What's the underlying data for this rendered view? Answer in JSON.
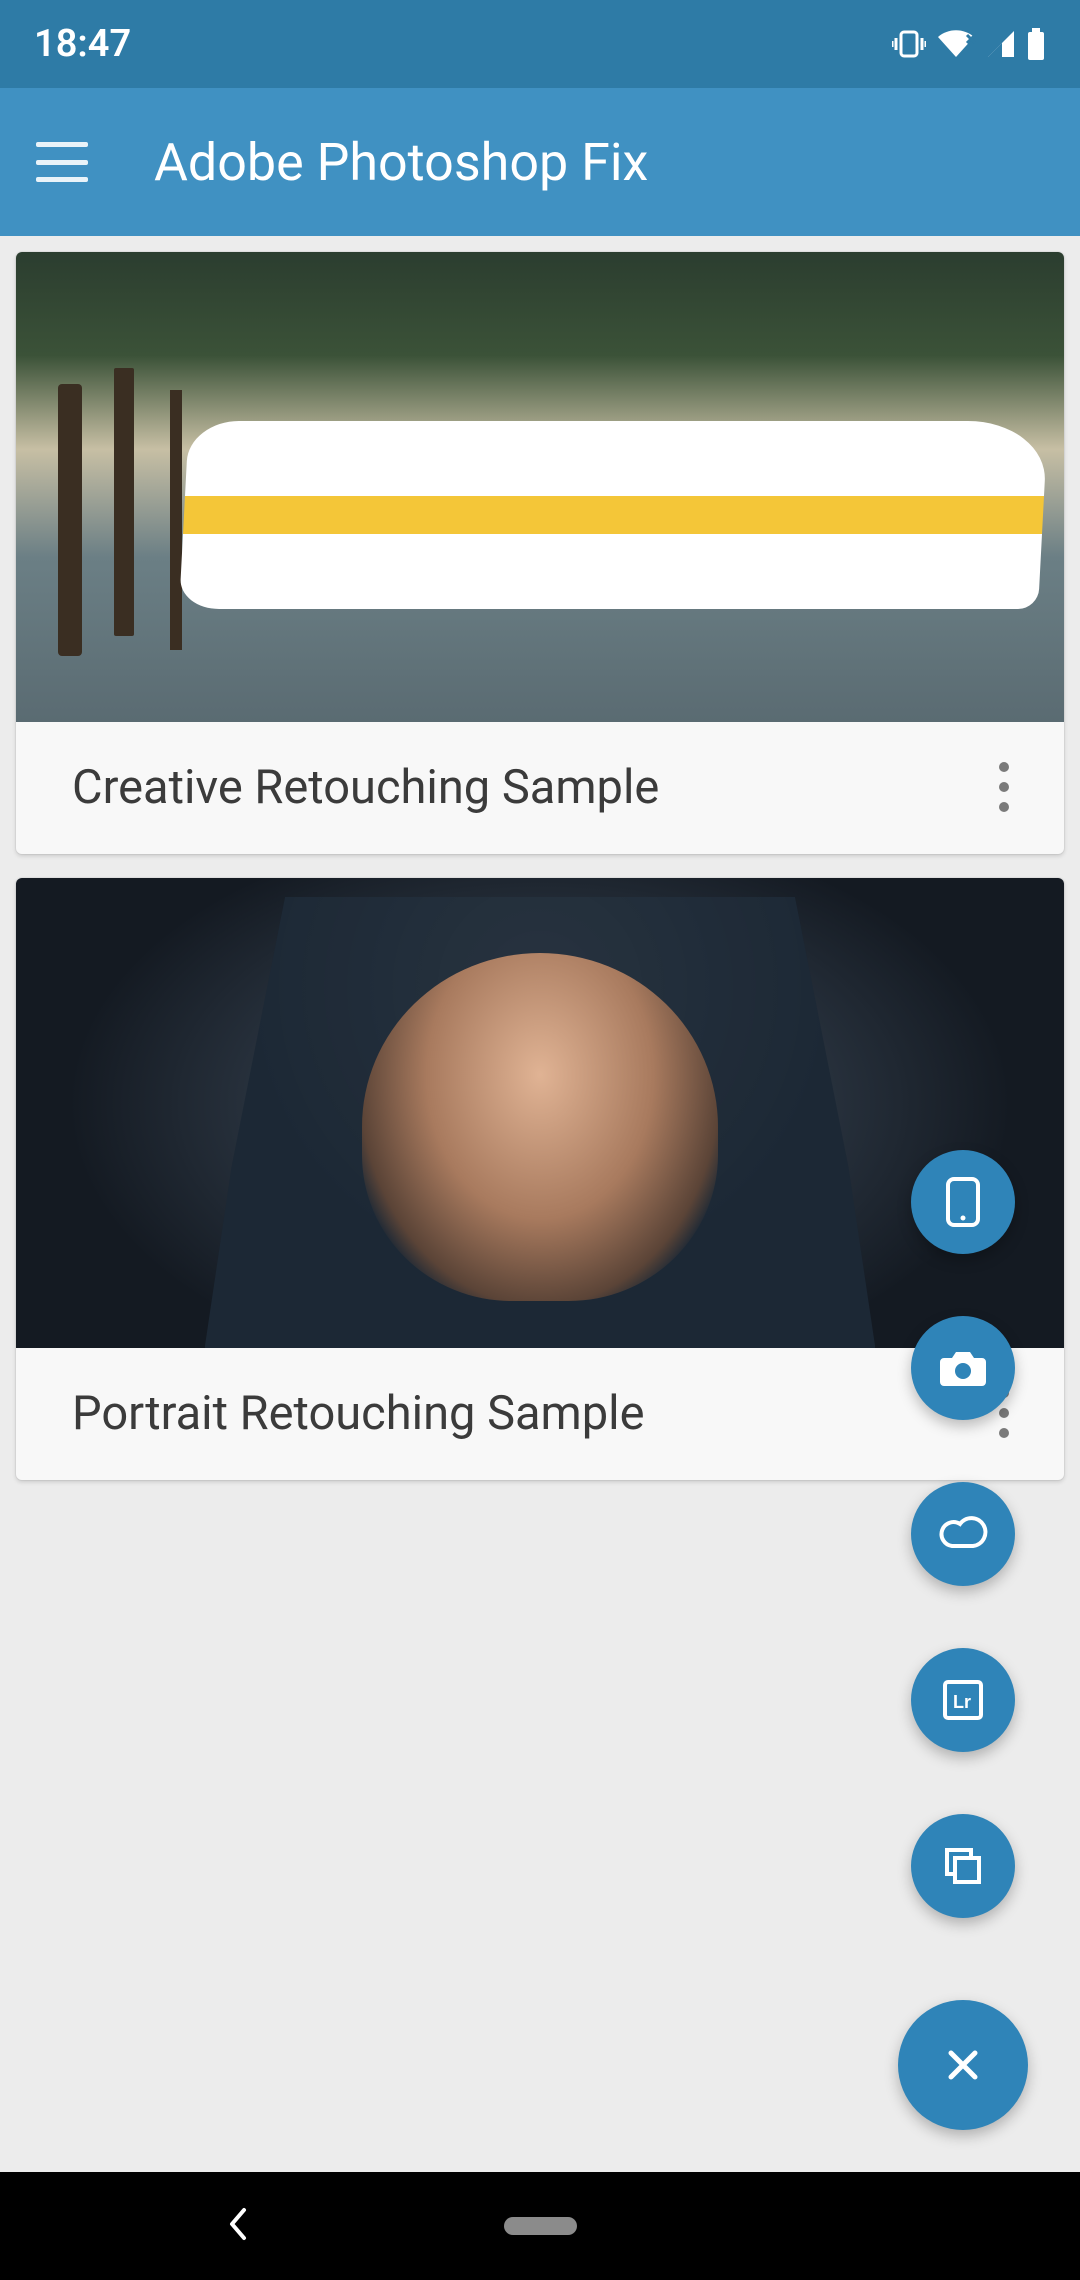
{
  "status": {
    "time": "18:47"
  },
  "app": {
    "title": "Adobe Photoshop Fix"
  },
  "projects": [
    {
      "title": "Creative Retouching Sample",
      "image": "seaplane"
    },
    {
      "title": "Portrait Retouching Sample",
      "image": "portrait"
    }
  ],
  "fab": {
    "items": [
      "phone",
      "camera",
      "creative-cloud",
      "lightroom",
      "files"
    ],
    "main": "close"
  }
}
